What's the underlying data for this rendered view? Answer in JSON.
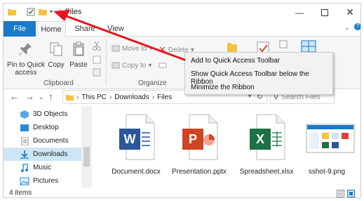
{
  "window": {
    "title": "Files"
  },
  "ribbon_tabs": {
    "file": "File",
    "home": "Home",
    "share": "Share",
    "view": "View"
  },
  "ribbon": {
    "pin_quick": "Pin to Quick",
    "pin_access": "access",
    "copy": "Copy",
    "paste": "Paste",
    "move_to": "Move to",
    "copy_to": "Copy to",
    "delete": "Delete",
    "clipboard_group": "Clipboard",
    "organize_group": "Organize"
  },
  "context_menu": {
    "items": [
      "Add to Quick Access Toolbar",
      "Show Quick Access Toolbar below the Ribbon",
      "Minimize the Ribbon"
    ]
  },
  "address": {
    "path": [
      "This PC",
      "Downloads",
      "Files"
    ],
    "search_placeholder": "Search Files"
  },
  "nav_pane": {
    "items": [
      "3D Objects",
      "Desktop",
      "Documents",
      "Downloads",
      "Music",
      "Pictures"
    ],
    "selected": "Downloads"
  },
  "files": [
    {
      "name": "Document.docx",
      "icon": "word-icon",
      "letter": "W",
      "color": "#2b579a"
    },
    {
      "name": "Presentation.pptx",
      "icon": "powerpoint-icon",
      "letter": "P",
      "color": "#d04423"
    },
    {
      "name": "Spreadsheet.xlsx",
      "icon": "excel-icon",
      "letter": "X",
      "color": "#1e7145"
    },
    {
      "name": "sshot-9.png",
      "icon": "image-thumbnail"
    }
  ],
  "status": {
    "item_count": "4 items"
  },
  "colors": {
    "file_tab": "#1979ca",
    "selection": "#cde6f7",
    "annotation_arrow": "#e8141c"
  }
}
